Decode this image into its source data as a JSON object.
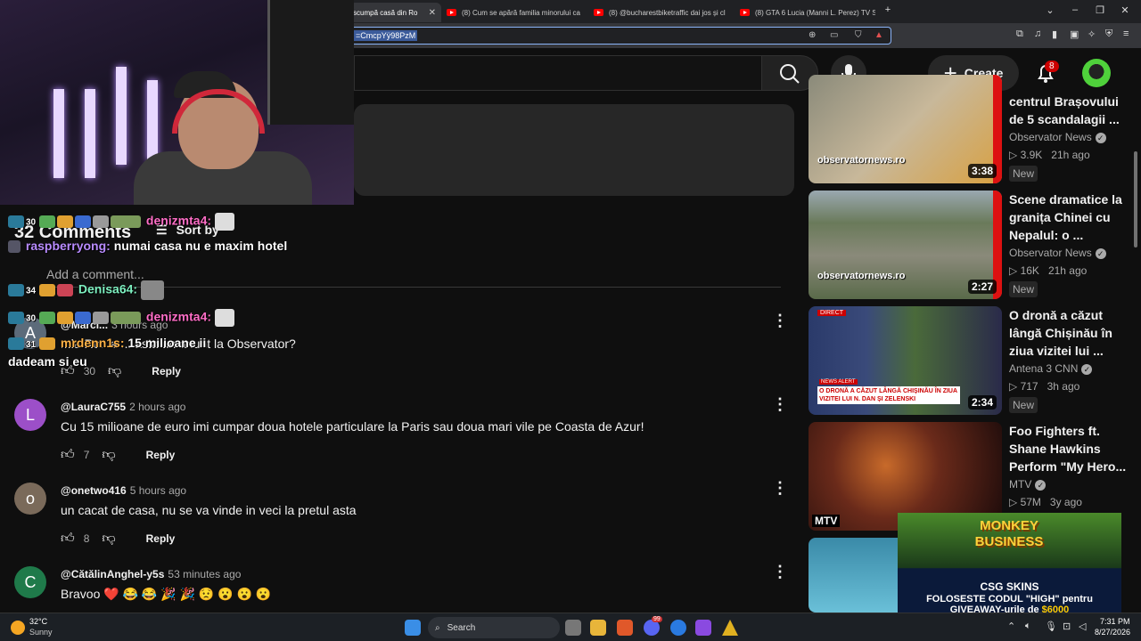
{
  "browser": {
    "tabs": [
      {
        "label": "scumpă casă din Ro"
      },
      {
        "label": "(8) Cum se apără familia minorului ca"
      },
      {
        "label": "(8) @bucharestbiketraffic dai jos și cl"
      },
      {
        "label": "(8) GTA 6 Lucia (Manni L. Perez) TV S"
      }
    ],
    "url_fragment": "=CmcpYÿ98PzM"
  },
  "youtube": {
    "create_label": "Create",
    "notifications_count": "8"
  },
  "comments": {
    "count_label": "32 Comments",
    "sort_label": "Sort by",
    "add_placeholder": "Add a comment...",
    "items": [
      {
        "author": "@Marci...",
        "time": "3 hours ago",
        "text": "...la Ro...a ... asta un anunt la Observator?",
        "likes": "30",
        "reply": "Reply",
        "initial": "A",
        "color": "#5c6b7a"
      },
      {
        "author": "@LauraC755",
        "time": "2 hours ago",
        "text": "Cu 15 milioane de euro imi cumpar doua hotele particulare la Paris sau doua mari vile pe Coasta de Azur!",
        "likes": "7",
        "reply": "Reply",
        "initial": "L",
        "color": "#9c4fc8"
      },
      {
        "author": "@onetwo416",
        "time": "5 hours ago",
        "text": "un cacat de casa, nu se va vinde in veci la pretul asta",
        "likes": "8",
        "reply": "Reply",
        "initial": "o",
        "color": "#7a6a5a"
      },
      {
        "author": "@CătălinAnghel-y5s",
        "time": "53 minutes ago",
        "text": "Bravoo ❤️ 😂 😂 🎉 🎉 😟 😮 😮 😮",
        "likes": "",
        "reply": "",
        "initial": "C",
        "color": "#1f7a4a"
      }
    ]
  },
  "chat": {
    "lines": [
      {
        "badge": "30",
        "user": "denizmta4:",
        "user_color": "#ff6ec7",
        "msg": ""
      },
      {
        "badge": "",
        "user": "raspberryong:",
        "user_color": "#b98cff",
        "msg": "numai casa nu e maxim hotel"
      },
      {
        "badge": "34",
        "user": "Denisa64:",
        "user_color": "#7ef0c0",
        "msg": ""
      },
      {
        "badge": "30",
        "user": "denizmta4:",
        "user_color": "#ff6ec7",
        "msg": ""
      },
      {
        "badge": "31",
        "user": "mrdenn1s:",
        "user_color": "#ffb347",
        "msg": "15 milioane ii dadeam si eu"
      }
    ]
  },
  "sidebar": {
    "videos": [
      {
        "title": "centrul Brașovului de 5 scandalagii ...",
        "channel": "Observator News",
        "views": "3.9K",
        "age": "21h ago",
        "badge": "New",
        "duration": "3:38",
        "watermark": "observatornews.ro"
      },
      {
        "title": "Scene dramatice la granița Chinei cu Nepalul: o ...",
        "channel": "Observator News",
        "views": "16K",
        "age": "21h ago",
        "badge": "New",
        "duration": "2:27",
        "watermark": "observatornews.ro"
      },
      {
        "title": "O dronă a căzut lângă Chișinău în ziua vizitei lui ...",
        "channel": "Antena 3 CNN",
        "views": "717",
        "age": "3h ago",
        "badge": "New",
        "duration": "2:34",
        "watermark": ""
      },
      {
        "title": "Foo Fighters ft. Shane Hawkins Perform \"My Hero...",
        "channel": "MTV",
        "views": "57M",
        "age": "3y ago",
        "badge": "",
        "duration": "",
        "watermark": ""
      }
    ],
    "news_ticker": "O DRONĂ A CĂZUT LÂNGĂ CHIȘINĂU ÎN ZIUA VIZITEI LUI N. DAN ȘI ZELENSKI",
    "live_tag": "DIRECT",
    "news_tag": "NEWS ALERT",
    "mtv_logo": "MTV"
  },
  "ad": {
    "game_title": "MONKEY BUSINESS",
    "brand": "CSG SKINS",
    "line1": "FOLOSESTE CODUL \"HIGH\" pentru",
    "line2_prefix": "GIVEAWAY-urile de ",
    "amount": "$6000",
    "amount_color": "#ffcc00"
  },
  "taskbar": {
    "temp": "32°C",
    "weather": "Sunny",
    "search_label": "Search",
    "time": "7:31 PM",
    "date": "8/27/2026",
    "messenger_badge": "99"
  }
}
